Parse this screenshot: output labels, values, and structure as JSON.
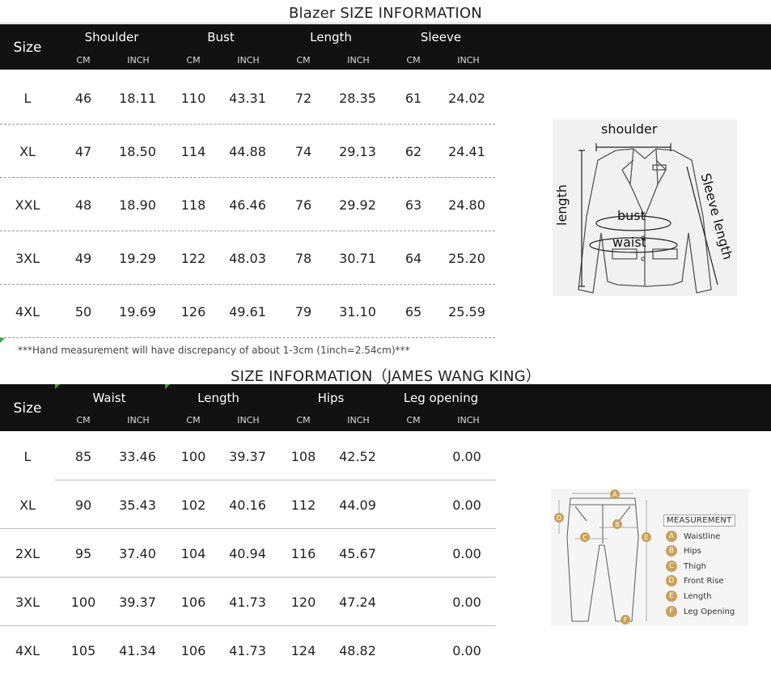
{
  "blazer": {
    "title": "Blazer SIZE INFORMATION",
    "size_label": "Size",
    "groups": [
      "Shoulder",
      "Bust",
      "Length",
      "Sleeve"
    ],
    "units": [
      "CM",
      "INCH"
    ],
    "rows": [
      {
        "size": "L",
        "values": [
          "46",
          "18.11",
          "110",
          "43.31",
          "72",
          "28.35",
          "61",
          "24.02"
        ]
      },
      {
        "size": "XL",
        "values": [
          "47",
          "18.50",
          "114",
          "44.88",
          "74",
          "29.13",
          "62",
          "24.41"
        ]
      },
      {
        "size": "XXL",
        "values": [
          "48",
          "18.90",
          "118",
          "46.46",
          "76",
          "29.92",
          "63",
          "24.80"
        ]
      },
      {
        "size": "3XL",
        "values": [
          "49",
          "19.29",
          "122",
          "48.03",
          "78",
          "30.71",
          "64",
          "25.20"
        ]
      },
      {
        "size": "4XL",
        "values": [
          "50",
          "19.69",
          "126",
          "49.61",
          "79",
          "31.10",
          "65",
          "25.59"
        ]
      }
    ],
    "note": "***Hand measurement will have discrepancy of about 1-3cm (1inch=2.54cm)***",
    "diagram": {
      "shoulder": "shoulder",
      "length": "length",
      "bust": "bust",
      "waist": "waist",
      "sleeve": "Sleeve length"
    }
  },
  "pants": {
    "title": "SIZE INFORMATION（JAMES WANG KING）",
    "size_label": "Size",
    "groups": [
      "Waist",
      "Length",
      "Hips",
      "Leg opening"
    ],
    "units": [
      "CM",
      "INCH"
    ],
    "rows": [
      {
        "size": "L",
        "values": [
          "85",
          "33.46",
          "100",
          "39.37",
          "108",
          "42.52",
          "",
          "0.00"
        ]
      },
      {
        "size": "XL",
        "values": [
          "90",
          "35.43",
          "102",
          "40.16",
          "112",
          "44.09",
          "",
          "0.00"
        ]
      },
      {
        "size": "2XL",
        "values": [
          "95",
          "37.40",
          "104",
          "40.94",
          "116",
          "45.67",
          "",
          "0.00"
        ]
      },
      {
        "size": "3XL",
        "values": [
          "100",
          "39.37",
          "106",
          "41.73",
          "120",
          "47.24",
          "",
          "0.00"
        ]
      },
      {
        "size": "4XL",
        "values": [
          "105",
          "41.34",
          "106",
          "41.73",
          "124",
          "48.82",
          "",
          "0.00"
        ]
      }
    ],
    "diagram": {
      "measurement_title": "MEASUREMENT",
      "legend": [
        {
          "letter": "A",
          "label": "Waistline"
        },
        {
          "letter": "B",
          "label": "Hips"
        },
        {
          "letter": "C",
          "label": "Thigh"
        },
        {
          "letter": "D",
          "label": "Front Rise"
        },
        {
          "letter": "E",
          "label": "Length"
        },
        {
          "letter": "F",
          "label": "Leg Opening"
        }
      ],
      "markers": [
        "A",
        "B",
        "C",
        "D",
        "E",
        "F"
      ]
    }
  },
  "colors": {
    "header_bg": "#111111",
    "separator": "#9a9a9a",
    "accent_green": "#3aa84a",
    "marker": "#c9a15a"
  }
}
